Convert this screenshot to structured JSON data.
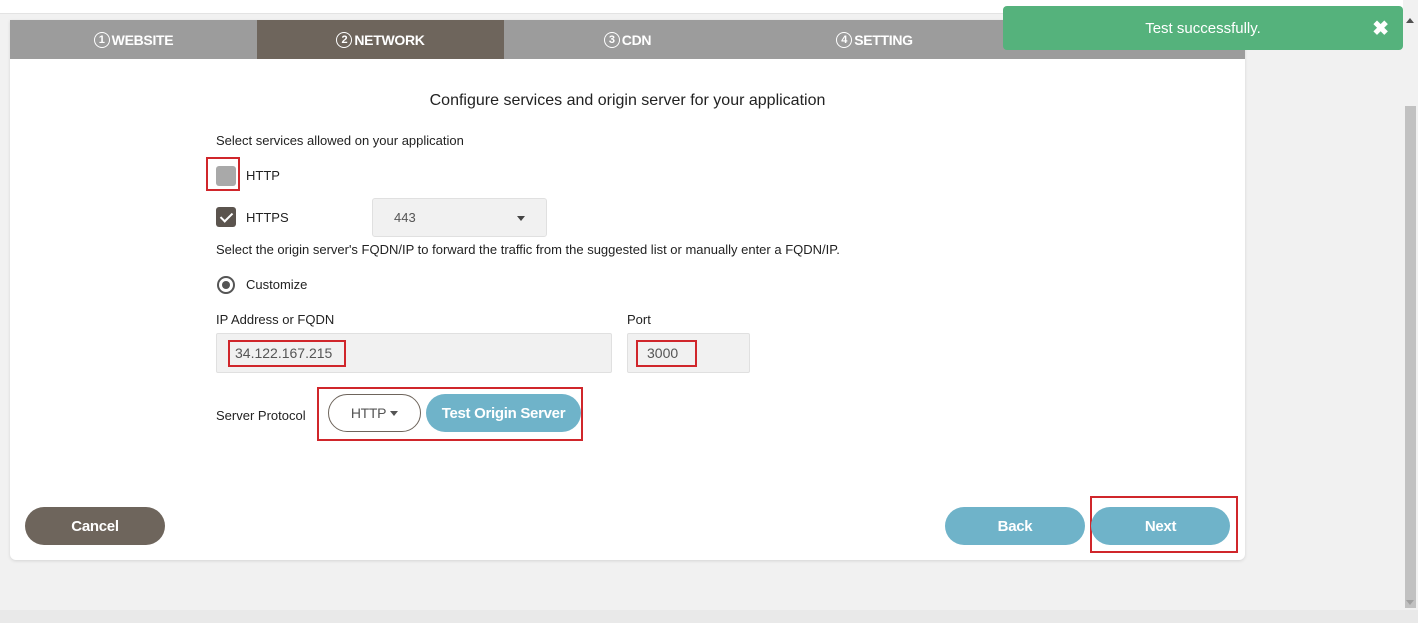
{
  "steps": [
    {
      "num": "1",
      "label": "WEBSITE"
    },
    {
      "num": "2",
      "label": "NETWORK"
    },
    {
      "num": "3",
      "label": "CDN"
    },
    {
      "num": "4",
      "label": "SETTING"
    }
  ],
  "heading": "Configure services and origin server for your application",
  "services": {
    "label": "Select services allowed on your application",
    "http": {
      "label": "HTTP",
      "checked": false
    },
    "https": {
      "label": "HTTPS",
      "checked": true,
      "port": "443"
    }
  },
  "origin": {
    "description": "Select the origin server's FQDN/IP to forward the traffic from the suggested list or manually enter a FQDN/IP.",
    "customize_label": "Customize",
    "ip_label": "IP Address or FQDN",
    "ip_value": "34.122.167.215",
    "port_label": "Port",
    "port_value": "3000",
    "protocol_label": "Server Protocol",
    "protocol_value": "HTTP",
    "test_button": "Test Origin Server"
  },
  "footer": {
    "cancel": "Cancel",
    "back": "Back",
    "next": "Next"
  },
  "toast": {
    "message": "Test successfully.",
    "close": "✖"
  },
  "colors": {
    "step_active": "#6e655c",
    "step_inactive": "#9c9c9c",
    "teal_button": "#6fb3c9",
    "toast": "#55b27c",
    "highlight": "#d0262b"
  }
}
